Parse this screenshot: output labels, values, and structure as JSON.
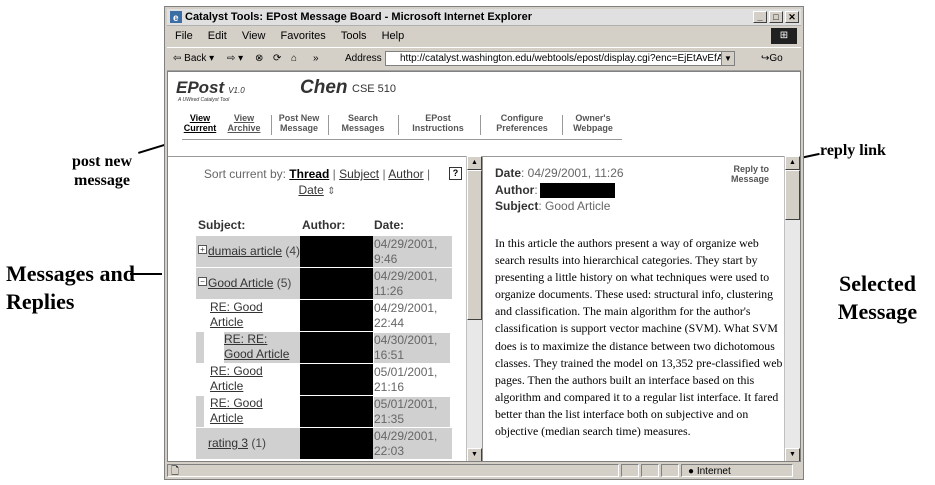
{
  "annotations": {
    "post_new_message": "post new message",
    "messages_and_replies": "Messages and Replies",
    "reply_link": "reply link",
    "selected_message": "Selected Message"
  },
  "window": {
    "title": "Catalyst Tools: EPost Message Board - Microsoft Internet Explorer",
    "menu": [
      "File",
      "Edit",
      "View",
      "Favorites",
      "Tools",
      "Help"
    ],
    "toolbar": {
      "back": "Back",
      "address_label": "Address",
      "url": "http://catalyst.washington.edu/webtools/epost/display.cgi?enc=EjEtAvEfAxCE",
      "go": "Go"
    },
    "status": {
      "zone": "Internet"
    }
  },
  "header": {
    "logo": "EPost",
    "version": "V1.0",
    "tagline": "A UWired Catalyst Tool",
    "user": "Chen",
    "course": "CSE 510"
  },
  "nav": [
    {
      "line1": "View",
      "line2": "Current"
    },
    {
      "line1": "View",
      "line2": "Archive"
    },
    {
      "line1": "Post New",
      "line2": "Message"
    },
    {
      "line1": "Search",
      "line2": "Messages"
    },
    {
      "line1": "EPost",
      "line2": "Instructions"
    },
    {
      "line1": "Configure",
      "line2": "Preferences"
    },
    {
      "line1": "Owner's",
      "line2": "Webpage"
    }
  ],
  "sort": {
    "prefix": "Sort current by:",
    "thread": "Thread",
    "subject": "Subject",
    "author": "Author",
    "date": "Date"
  },
  "columns": {
    "subject": "Subject:",
    "author": "Author:",
    "date": "Date:"
  },
  "messages": [
    {
      "subject": "dumais article",
      "count": "(4)",
      "date": "04/29/2001, 9:46"
    },
    {
      "subject": "Good Article",
      "count": "(5)",
      "date": "04/29/2001, 11:26"
    },
    {
      "subject_l1": "RE: Good",
      "subject_l2": "Article",
      "date": "04/29/2001, 22:44"
    },
    {
      "subject_l1": "RE: RE:",
      "subject_l2": "Good Article",
      "date": "04/30/2001, 16:51"
    },
    {
      "subject_l1": "RE: Good",
      "subject_l2": "Article",
      "date": "05/01/2001, 21:16"
    },
    {
      "subject_l1": "RE: Good",
      "subject_l2": "Article",
      "date": "05/01/2001, 21:35"
    },
    {
      "subject": "rating 3",
      "count": "(1)",
      "date": "04/29/2001, 22:03"
    }
  ],
  "selected": {
    "date_label": "Date",
    "date": ": 04/29/2001, 11:26",
    "author_label": "Author",
    "subject_label": "Subject",
    "subject": ": Good Article",
    "reply_l1": "Reply to",
    "reply_l2": "Message",
    "body": "In this article the authors present a way of organize web search results into hierarchical categories. They start by presenting a little history on what techniques were used to organize documents. These used: structural info, clustering and classification. The main algorithm for the author's classification is support vector machine (SVM). What SVM does is to maximize the distance between two dichotomous classes. They trained the model on 13,352 pre-classified web pages. Then the authors built an interface based on this algorithm and compared it to a regular list interface. It fared better than the list interface both on subjective and on objective (median search time) measures."
  }
}
